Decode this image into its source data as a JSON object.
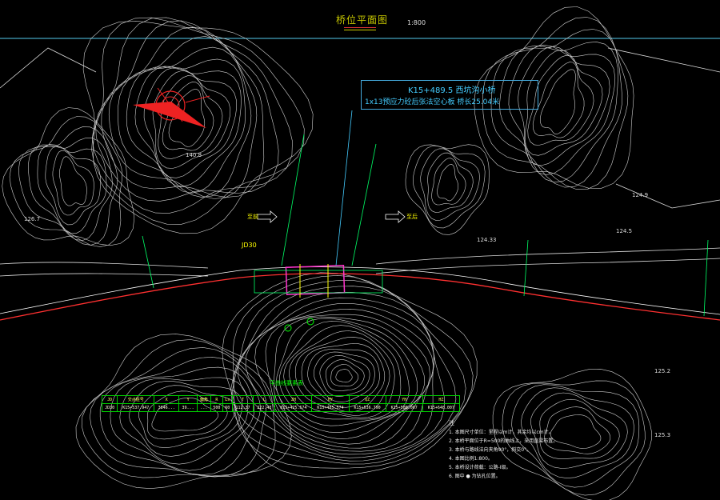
{
  "drawing": {
    "title": "桥位平面图",
    "scale": "1:800",
    "bridge_info": {
      "line1": "K15+489.5 西坑沟小桥",
      "line2": "1x13预应力砼后张法空心板 桥长25.04米"
    },
    "jd_label": "JD30",
    "arrow_left": "至前",
    "arrow_right": "至后",
    "table_caption": "平曲线要素表",
    "curve_table": {
      "headers": [
        "JD",
        "交点桩号",
        "X",
        "Y",
        "偏角",
        "R",
        "Ls",
        "T",
        "L",
        "ZH",
        "HY",
        "QZ",
        "YH",
        "HZ"
      ],
      "row": [
        "JD30",
        "K15+537.947",
        "3846...",
        "39...",
        "...",
        "500",
        "60",
        "112.37",
        "222.43",
        "K15+425.574",
        "K15+485.574",
        "K15+536.790",
        "K15+588.007",
        "K15+648.007"
      ]
    },
    "notes": {
      "head": "注",
      "items": [
        "1. 本图尺寸单位：里程以m计，其余均以cm计。",
        "2. 本桥平面位于R=500的曲线上，采用直梁布置。",
        "3. 本桥与路线法向夹角90°，斜交0°。",
        "4. 本图比例1:800。",
        "5. 本桥设计荷载：公路-I级。",
        "6. 图中 ● 为钻孔位置。"
      ]
    },
    "elevation_labels": [
      "126.7",
      "124.5",
      "124.9",
      "125.2",
      "125.3",
      "124.33",
      "140.8"
    ],
    "colors": {
      "background": "#000000",
      "contour": "#cfcfcf",
      "route": "#ff3030",
      "title": "#c8c800",
      "bridge_box": "#44aadd",
      "survey_text": "#33ff33",
      "table_border": "#00cc00"
    }
  }
}
